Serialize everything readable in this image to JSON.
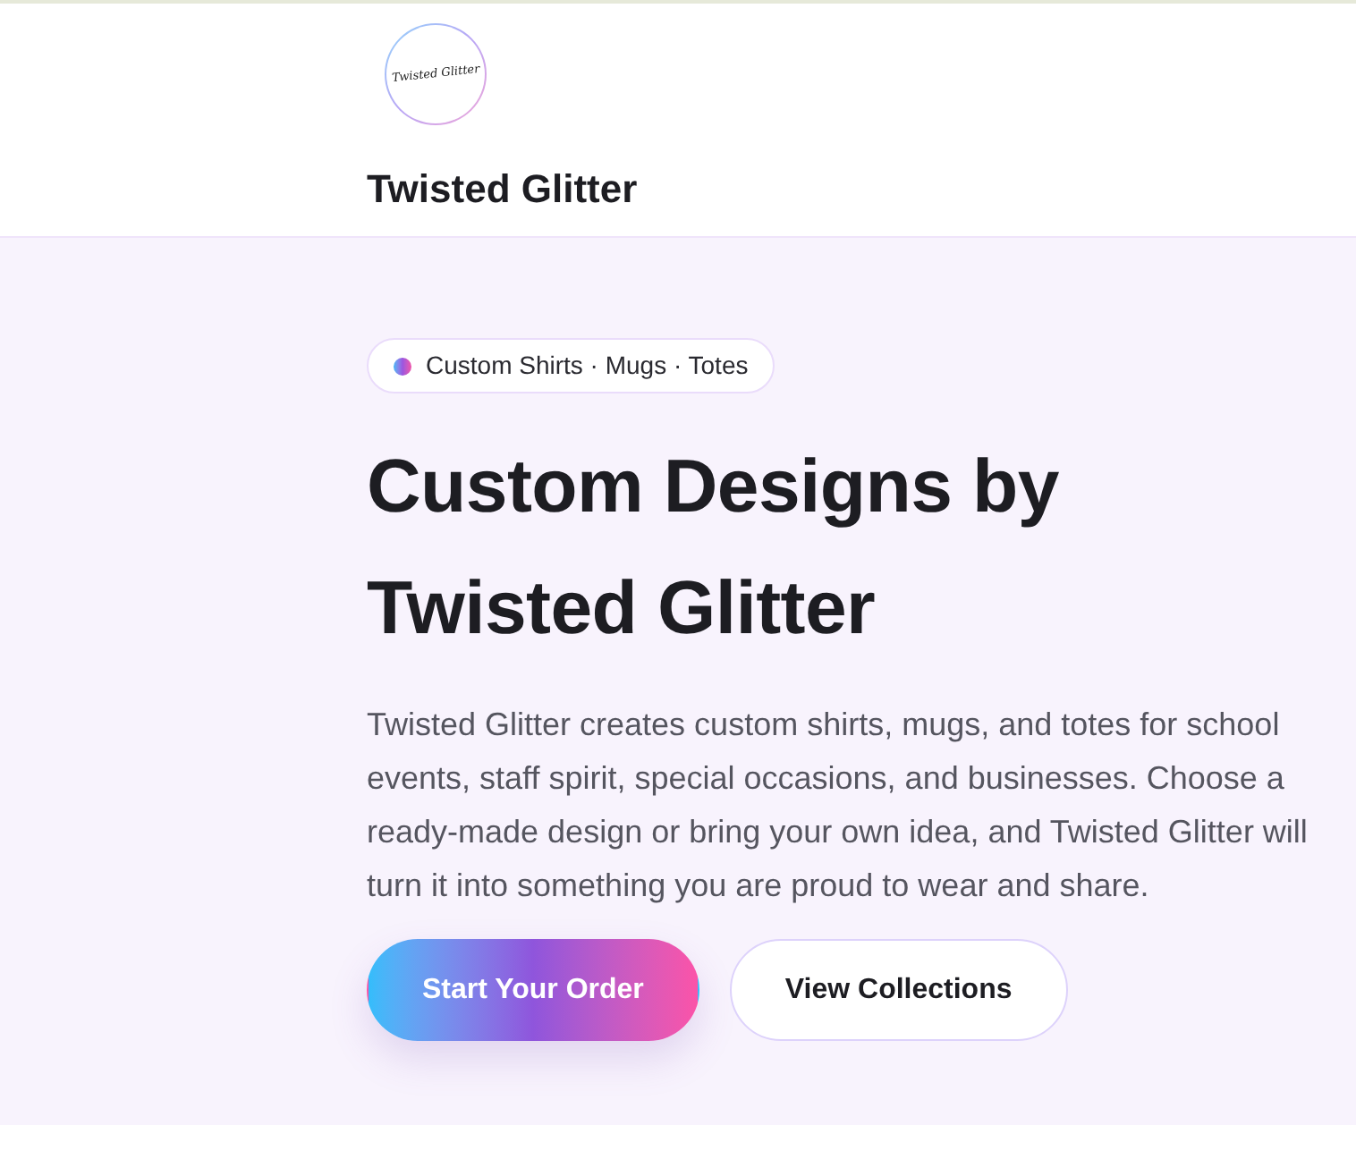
{
  "header": {
    "logo": {
      "script": "Twisted Glitter"
    },
    "brand": "Twisted Glitter"
  },
  "hero": {
    "badge": "Custom Shirts · Mugs · Totes",
    "title": "Custom Designs by Twisted Glitter",
    "description": "Twisted Glitter creates custom shirts, mugs, and totes for school events, staff spirit, special occasions, and businesses. Choose a ready-made design or bring your own idea, and Twisted Glitter will turn it into something you are proud to wear and share.",
    "buttons": [
      {
        "label": "Start Your Order",
        "kind": "primary"
      },
      {
        "label": "View Collections",
        "kind": "secondary"
      }
    ]
  }
}
